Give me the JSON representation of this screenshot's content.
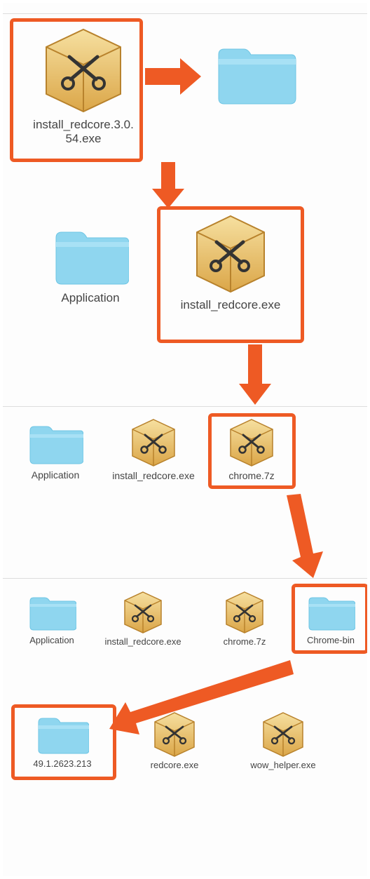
{
  "panels": {
    "p1": {
      "items": [
        {
          "id": "installer-1",
          "label": "install_redcore.3.0.54.exe"
        },
        {
          "id": "folder-1",
          "label": ""
        }
      ]
    },
    "p2": {
      "items": [
        {
          "id": "application-2",
          "label": "Application"
        },
        {
          "id": "installer-2",
          "label": "install_redcore.exe"
        }
      ]
    },
    "p3": {
      "items": [
        {
          "id": "application-3",
          "label": "Application"
        },
        {
          "id": "installer-3",
          "label": "install_redcore.exe"
        },
        {
          "id": "chrome7z-3",
          "label": "chrome.7z"
        }
      ]
    },
    "p4": {
      "items": [
        {
          "id": "application-4",
          "label": "Application"
        },
        {
          "id": "installer-4",
          "label": "install_redcore.exe"
        },
        {
          "id": "chrome7z-4",
          "label": "chrome.7z"
        },
        {
          "id": "chromebin-4",
          "label": "Chrome-bin"
        },
        {
          "id": "versionfolder-4",
          "label": "49.1.2623.213"
        },
        {
          "id": "redcore-4",
          "label": "redcore.exe"
        },
        {
          "id": "wowhelper-4",
          "label": "wow_helper.exe"
        }
      ]
    }
  }
}
